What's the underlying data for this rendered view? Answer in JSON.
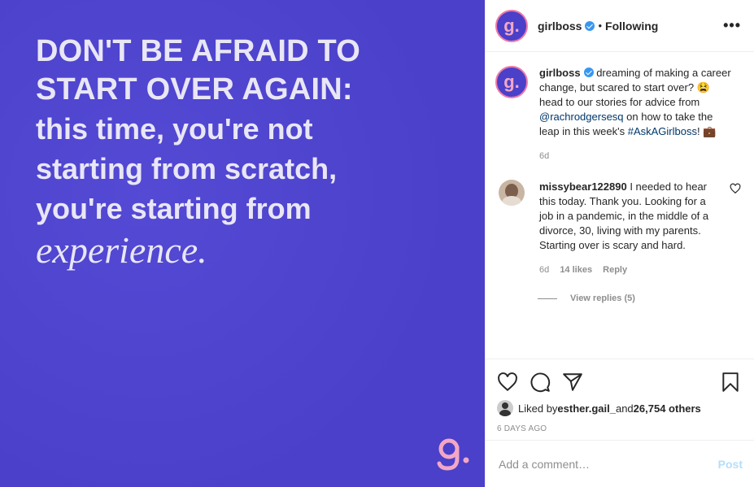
{
  "post": {
    "quote_line1": "DON'T BE AFRAID TO",
    "quote_line2": "START OVER AGAIN:",
    "quote_line3": "this time,  you're not",
    "quote_line4": "starting from scratch,",
    "quote_line5": "you're starting from",
    "quote_line6": "experience.",
    "brand_mark": "g."
  },
  "header": {
    "username": "girlboss",
    "separator": "•",
    "following_label": "Following",
    "more_label": "•••"
  },
  "caption": {
    "username": "girlboss",
    "text_part1": " dreaming of making a career change, but scared to start over? 😫 head to our stories for advice from ",
    "mention": "@rachrodgersesq",
    "text_part2": " on how to take the leap in this week's ",
    "hashtag": "#AskAGirlboss",
    "text_part3": "! 💼",
    "time": "6d"
  },
  "comment": {
    "username": "missybear122890",
    "text": " I needed to hear this today. Thank you. Looking for a job in a pandemic, in the middle of a divorce, 30, living with my parents. Starting over is scary and hard.",
    "time": "6d",
    "likes": "14 likes",
    "reply_label": "Reply",
    "view_replies": "View replies (5)"
  },
  "likes": {
    "prefix": "Liked by ",
    "liker": "esther.gail_",
    "middle": " and ",
    "count": "26,754 others"
  },
  "post_date": "6 DAYS AGO",
  "add_comment": {
    "placeholder": "Add a comment…",
    "post_label": "Post"
  },
  "colors": {
    "post_background": "#4a40c9",
    "brand_pink": "#f3a7c5",
    "link": "#00376b",
    "verified": "#3897f0"
  },
  "icons": [
    "verified-badge-icon",
    "heart-icon",
    "comment-icon",
    "share-icon",
    "bookmark-icon",
    "more-icon"
  ]
}
